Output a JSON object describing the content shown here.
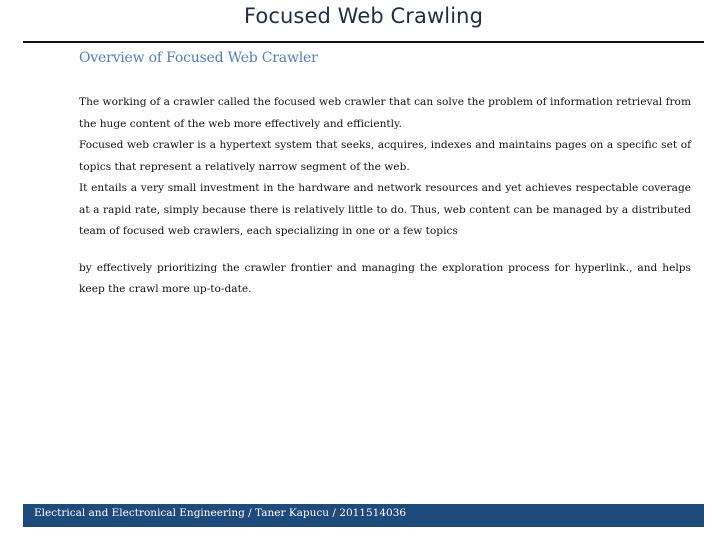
{
  "slide": {
    "title": "Focused Web Crawling",
    "subheading": "Overview of Focused Web Crawler",
    "paragraphs": [
      "The working of a crawler called the focused web crawler that can solve the problem of information retrieval from the huge content of the web more effectively and efficiently.",
      "Focused web crawler is a hypertext system that seeks, acquires, indexes and maintains pages on a specific set of topics that represent a relatively narrow segment of the web.",
      "It entails a very small investment in the hardware and network resources and yet achieves respectable coverage at a rapid rate, simply because there is relatively little to do. Thus, web content can be managed by a distributed team of focused web crawlers, each specializing in one or a few topics",
      "by effectively prioritizing the crawler frontier and managing the exploration process for hyperlink., and helps keep the crawl more up-to-date."
    ]
  },
  "footer": {
    "text": "Electrical and Electronical Engineering / Taner Kapucu /  2011514036"
  },
  "colors": {
    "title": "#1f2d45",
    "subheading": "#4f7fbd",
    "footer_bar": "#1f4a7c",
    "footer_text": "#ffffff",
    "rule": "#111111"
  }
}
